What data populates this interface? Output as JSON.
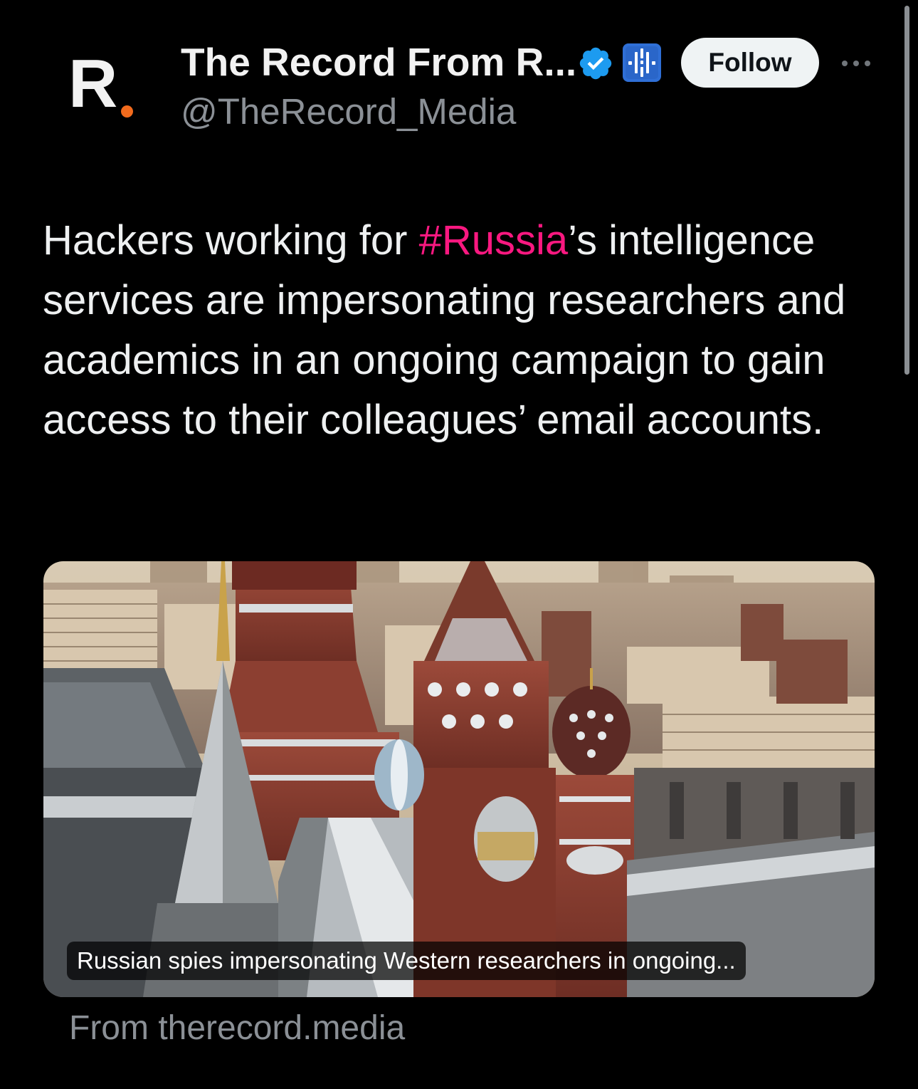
{
  "account": {
    "display_name": "The Record From R...",
    "handle": "@TheRecord_Media",
    "avatar_letter": "R",
    "avatar_dot_color": "#f26b1d",
    "verified_badge": "verified-badge-icon",
    "affiliate_badge": "recorded-future-affiliate-icon"
  },
  "actions": {
    "follow_label": "Follow",
    "more_icon": "more-options-icon"
  },
  "tweet": {
    "text_before": "Hackers working for ",
    "hashtag": "#Russia",
    "text_after": "’s intelligence services are impersonating researchers and academics in an ongoing campaign to gain access to their colleagues’ email accounts.",
    "hashtag_color": "#f91880"
  },
  "card": {
    "image": "moscow-kremlin-winter-photo",
    "title": "Russian spies impersonating Western researchers in ongoing...",
    "source": "From therecord.media"
  },
  "colors": {
    "background": "#000000",
    "text": "#e7e9ea",
    "secondary_text": "#8b9096",
    "verified_blue": "#1d9bf0"
  }
}
